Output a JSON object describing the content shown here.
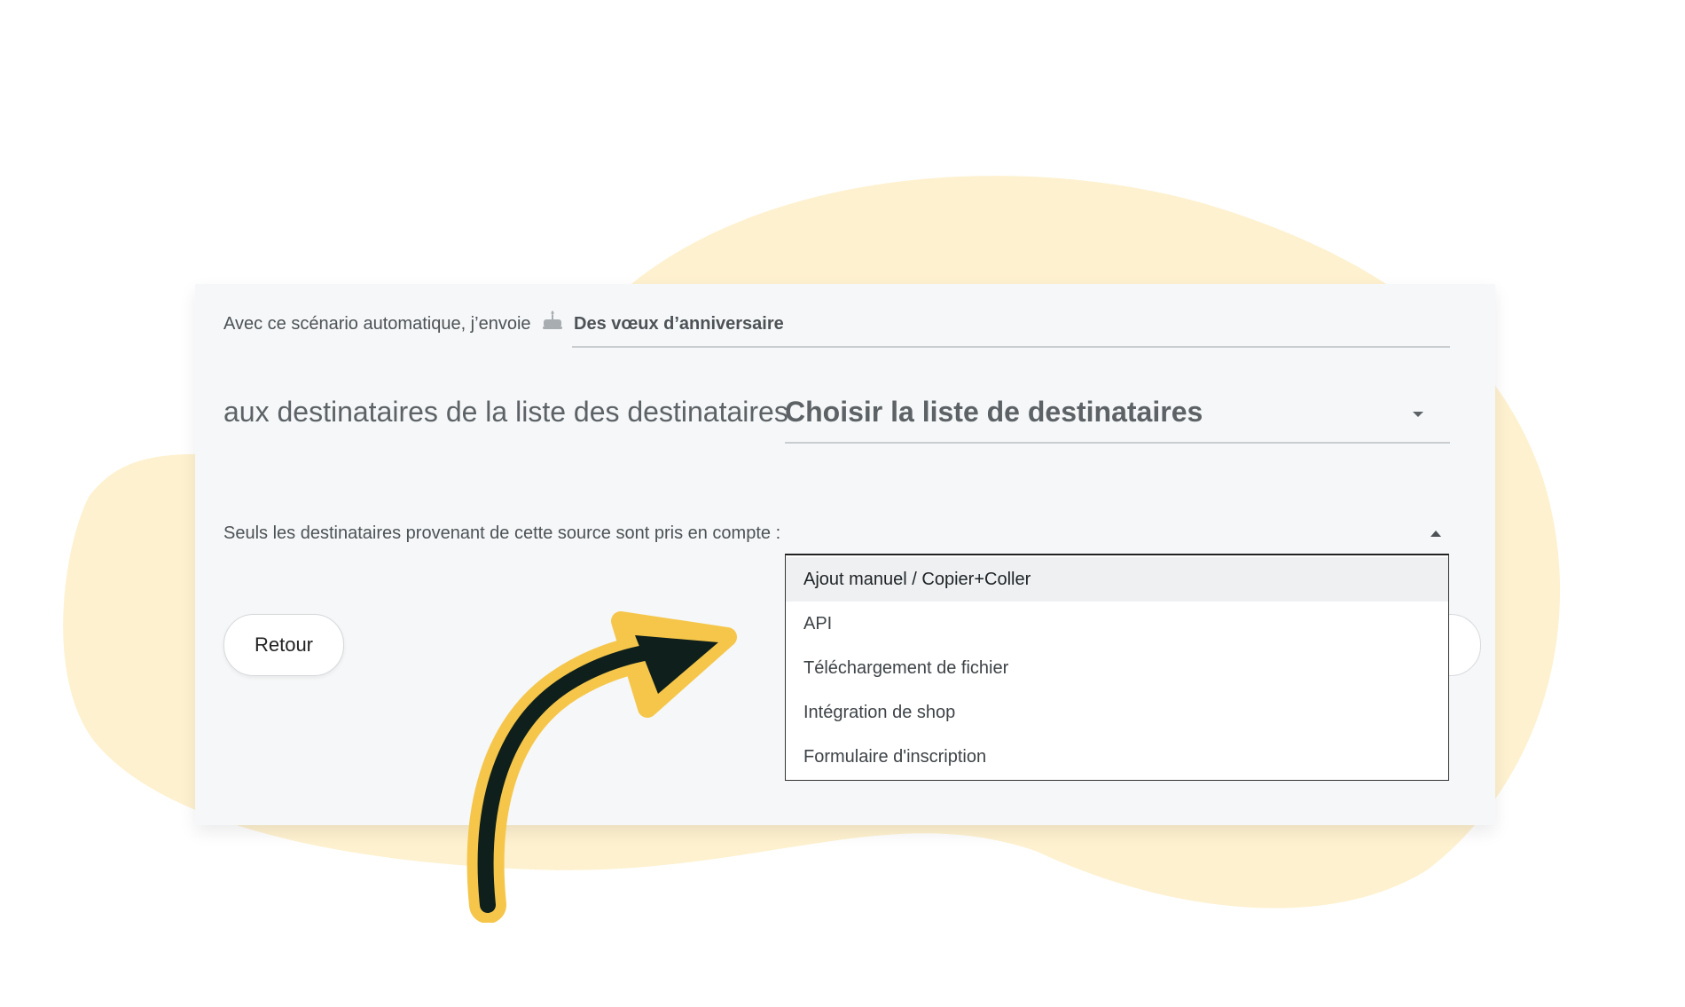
{
  "scenario": {
    "intro_label": "Avec ce scénario automatique, j’envoie",
    "campaign_icon": "cake-icon",
    "campaign_value": "Des vœux d’anniversaire"
  },
  "recipients": {
    "label": "aux destinataires de la liste des destinataires",
    "placeholder": "Choisir la liste de destinataires"
  },
  "source": {
    "label": "Seuls les destinataires provenant de cette source sont pris en compte :",
    "options": [
      "Ajout manuel / Copier+Coller",
      "API",
      "Téléchargement de fichier",
      "Intégration de shop",
      "Formulaire d'inscription"
    ],
    "highlighted_option": "Ajout manuel / Copier+Coller"
  },
  "actions": {
    "back_label": "Retour"
  },
  "colors": {
    "blob": "#fef1cf",
    "arrow_fill": "#0e1f1c",
    "arrow_outline": "#f5c64a"
  }
}
